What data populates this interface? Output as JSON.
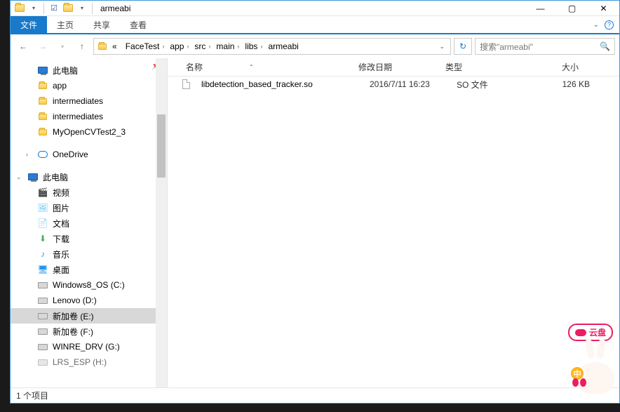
{
  "title": "armeabi",
  "ribbon": {
    "file": "文件",
    "home": "主页",
    "share": "共享",
    "view": "查看"
  },
  "breadcrumb": [
    "FaceTest",
    "app",
    "src",
    "main",
    "libs",
    "armeabi"
  ],
  "search_placeholder": "搜索\"armeabi\"",
  "columns": {
    "name": "名称",
    "date": "修改日期",
    "type": "类型",
    "size": "大小"
  },
  "files": [
    {
      "name": "libdetection_based_tracker.so",
      "date": "2016/7/11 16:23",
      "type": "SO 文件",
      "size": "126 KB"
    }
  ],
  "sidebar": {
    "quick": "此电脑",
    "qitems": [
      "app",
      "intermediates",
      "intermediates",
      "MyOpenCVTest2_3"
    ],
    "onedrive": "OneDrive",
    "thispc": "此电脑",
    "pcitems": [
      "视频",
      "图片",
      "文档",
      "下载",
      "音乐",
      "桌面",
      "Windows8_OS (C:)",
      "Lenovo (D:)",
      "新加卷 (E:)",
      "新加卷 (F:)",
      "WINRE_DRV (G:)",
      "LRS_ESP (H:)"
    ],
    "selected": 8
  },
  "status": "1 个项目",
  "mascot": {
    "label": "云盘",
    "badge": "中"
  }
}
